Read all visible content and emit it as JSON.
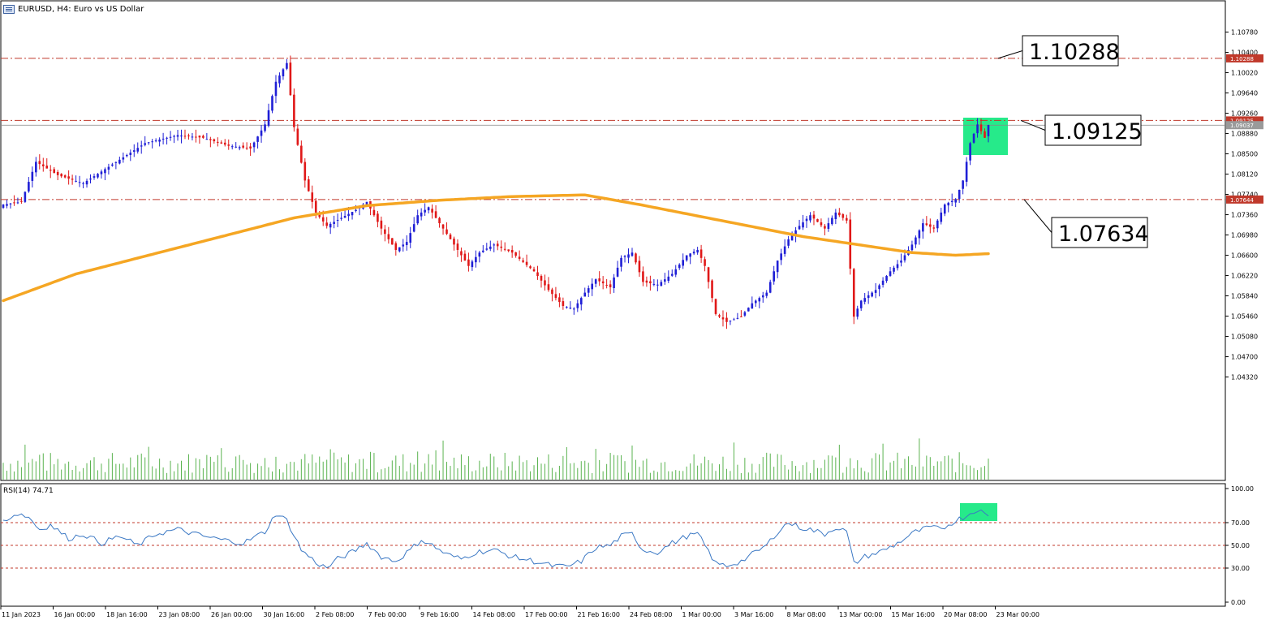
{
  "window": {
    "title": "EURUSD, H4:  Euro vs US Dollar",
    "menu_icon": "chart-menu-icon"
  },
  "chart_data": [
    {
      "type": "candlestick",
      "symbol": "EURUSD",
      "timeframe": "H4",
      "ylim": [
        1.0477,
        1.1078
      ],
      "y_ticks": [
        "1.10780",
        "1.10400",
        "1.10020",
        "1.09640",
        "1.09260",
        "1.08880",
        "1.08500",
        "1.08120",
        "1.07740",
        "1.07360",
        "1.06980",
        "1.06600",
        "1.06220",
        "1.05840",
        "1.05460",
        "1.05080",
        "1.04700",
        "1.04320"
      ],
      "x_ticks": [
        "11 Jan 2023",
        "16 Jan 00:00",
        "18 Jan 16:00",
        "23 Jan 08:00",
        "26 Jan 00:00",
        "30 Jan 16:00",
        "2 Feb 08:00",
        "7 Feb 00:00",
        "9 Feb 16:00",
        "14 Feb 08:00",
        "17 Feb 00:00",
        "21 Feb 16:00",
        "24 Feb 08:00",
        "1 Mar 00:00",
        "3 Mar 16:00",
        "8 Mar 08:00",
        "13 Mar 00:00",
        "15 Mar 16:00",
        "20 Mar 08:00",
        "23 Mar 00:00"
      ],
      "close_anchors": [
        [
          0,
          1.0755
        ],
        [
          5,
          1.076
        ],
        [
          9,
          1.0835
        ],
        [
          15,
          1.081
        ],
        [
          22,
          1.0795
        ],
        [
          30,
          1.083
        ],
        [
          39,
          1.087
        ],
        [
          48,
          1.0885
        ],
        [
          55,
          1.088
        ],
        [
          62,
          1.0865
        ],
        [
          68,
          1.086
        ],
        [
          72,
          1.0905
        ],
        [
          75,
          1.0985
        ],
        [
          78,
          1.102
        ],
        [
          80,
          1.09
        ],
        [
          83,
          1.08
        ],
        [
          86,
          1.074
        ],
        [
          89,
          1.0715
        ],
        [
          93,
          1.073
        ],
        [
          97,
          1.0745
        ],
        [
          100,
          1.076
        ],
        [
          104,
          1.071
        ],
        [
          108,
          1.067
        ],
        [
          111,
          1.0685
        ],
        [
          114,
          1.0735
        ],
        [
          117,
          1.075
        ],
        [
          120,
          1.072
        ],
        [
          124,
          1.068
        ],
        [
          128,
          1.064
        ],
        [
          131,
          1.0665
        ],
        [
          135,
          1.068
        ],
        [
          140,
          1.0665
        ],
        [
          146,
          1.063
        ],
        [
          150,
          1.0595
        ],
        [
          154,
          1.0565
        ],
        [
          157,
          1.056
        ],
        [
          160,
          1.059
        ],
        [
          163,
          1.0615
        ],
        [
          167,
          1.06
        ],
        [
          170,
          1.0655
        ],
        [
          173,
          1.0665
        ],
        [
          176,
          1.061
        ],
        [
          180,
          1.0605
        ],
        [
          184,
          1.0625
        ],
        [
          188,
          1.066
        ],
        [
          191,
          1.067
        ],
        [
          193,
          1.064
        ],
        [
          196,
          1.055
        ],
        [
          199,
          1.0535
        ],
        [
          203,
          1.0545
        ],
        [
          206,
          1.057
        ],
        [
          210,
          1.059
        ],
        [
          213,
          1.065
        ],
        [
          216,
          1.069
        ],
        [
          219,
          1.0715
        ],
        [
          222,
          1.0735
        ],
        [
          226,
          1.071
        ],
        [
          229,
          1.074
        ],
        [
          232,
          1.0725
        ],
        [
          234,
          1.0545
        ],
        [
          236,
          1.0575
        ],
        [
          240,
          1.0595
        ],
        [
          244,
          1.063
        ],
        [
          247,
          1.065
        ],
        [
          250,
          1.068
        ],
        [
          253,
          1.072
        ],
        [
          256,
          1.071
        ],
        [
          259,
          1.0755
        ],
        [
          262,
          1.0765
        ],
        [
          264,
          1.08
        ],
        [
          266,
          1.087
        ],
        [
          268,
          1.0905
        ],
        [
          270,
          1.088
        ],
        [
          271,
          1.0904
        ]
      ],
      "total_candles": 272,
      "last_close": "1.09037",
      "moving_average": {
        "color": "#f5a623",
        "points": [
          [
            0,
            1.0575
          ],
          [
            20,
            1.0625
          ],
          [
            40,
            1.066
          ],
          [
            60,
            1.0695
          ],
          [
            80,
            1.073
          ],
          [
            100,
            1.0753
          ],
          [
            120,
            1.0763
          ],
          [
            140,
            1.077
          ],
          [
            160,
            1.0773
          ],
          [
            175,
            1.0755
          ],
          [
            190,
            1.0735
          ],
          [
            205,
            1.0715
          ],
          [
            220,
            1.0695
          ],
          [
            235,
            1.068
          ],
          [
            250,
            1.0665
          ],
          [
            262,
            1.066
          ],
          [
            271,
            1.0663
          ]
        ]
      },
      "levels": [
        {
          "label": "1.10288",
          "value": 1.10288,
          "tag": "1.10288"
        },
        {
          "label": "1.09125",
          "value": 1.09125,
          "tag": "1.09125"
        },
        {
          "label": "1.07634",
          "value": 1.07644,
          "tag": "1.07644"
        }
      ],
      "colors": {
        "bull": "#1f1fd6",
        "bear": "#e01818",
        "level": "#c0392b",
        "volume": "#5ab34f",
        "highlight": "#00e676"
      }
    },
    {
      "type": "line",
      "name": "RSI(14) 74.71",
      "label": "RSI(14) 74.71",
      "ylim": [
        0,
        100
      ],
      "y_ticks": [
        "100.00",
        "70.00",
        "50.00",
        "30.00",
        "0.00"
      ],
      "levels": [
        70,
        50,
        30
      ],
      "anchors": [
        [
          0,
          72
        ],
        [
          4,
          78
        ],
        [
          7,
          75
        ],
        [
          10,
          64
        ],
        [
          13,
          68
        ],
        [
          18,
          56
        ],
        [
          22,
          60
        ],
        [
          27,
          52
        ],
        [
          32,
          58
        ],
        [
          37,
          50
        ],
        [
          42,
          60
        ],
        [
          48,
          64
        ],
        [
          55,
          58
        ],
        [
          60,
          55
        ],
        [
          66,
          52
        ],
        [
          72,
          62
        ],
        [
          75,
          78
        ],
        [
          78,
          72
        ],
        [
          82,
          46
        ],
        [
          86,
          35
        ],
        [
          89,
          30
        ],
        [
          92,
          38
        ],
        [
          96,
          44
        ],
        [
          100,
          52
        ],
        [
          104,
          40
        ],
        [
          108,
          36
        ],
        [
          112,
          46
        ],
        [
          115,
          55
        ],
        [
          118,
          50
        ],
        [
          122,
          42
        ],
        [
          126,
          38
        ],
        [
          130,
          44
        ],
        [
          135,
          46
        ],
        [
          140,
          40
        ],
        [
          146,
          36
        ],
        [
          151,
          32
        ],
        [
          155,
          31
        ],
        [
          159,
          36
        ],
        [
          163,
          48
        ],
        [
          167,
          50
        ],
        [
          170,
          58
        ],
        [
          173,
          60
        ],
        [
          176,
          46
        ],
        [
          180,
          44
        ],
        [
          184,
          52
        ],
        [
          188,
          58
        ],
        [
          191,
          60
        ],
        [
          193,
          50
        ],
        [
          196,
          34
        ],
        [
          199,
          32
        ],
        [
          203,
          36
        ],
        [
          206,
          42
        ],
        [
          210,
          50
        ],
        [
          213,
          62
        ],
        [
          216,
          70
        ],
        [
          219,
          66
        ],
        [
          222,
          64
        ],
        [
          226,
          60
        ],
        [
          229,
          66
        ],
        [
          232,
          62
        ],
        [
          234,
          34
        ],
        [
          237,
          40
        ],
        [
          241,
          44
        ],
        [
          245,
          50
        ],
        [
          248,
          56
        ],
        [
          251,
          62
        ],
        [
          255,
          66
        ],
        [
          258,
          64
        ],
        [
          262,
          72
        ],
        [
          265,
          76
        ],
        [
          268,
          82
        ],
        [
          271,
          75
        ]
      ],
      "color": "#3b78c4"
    }
  ]
}
